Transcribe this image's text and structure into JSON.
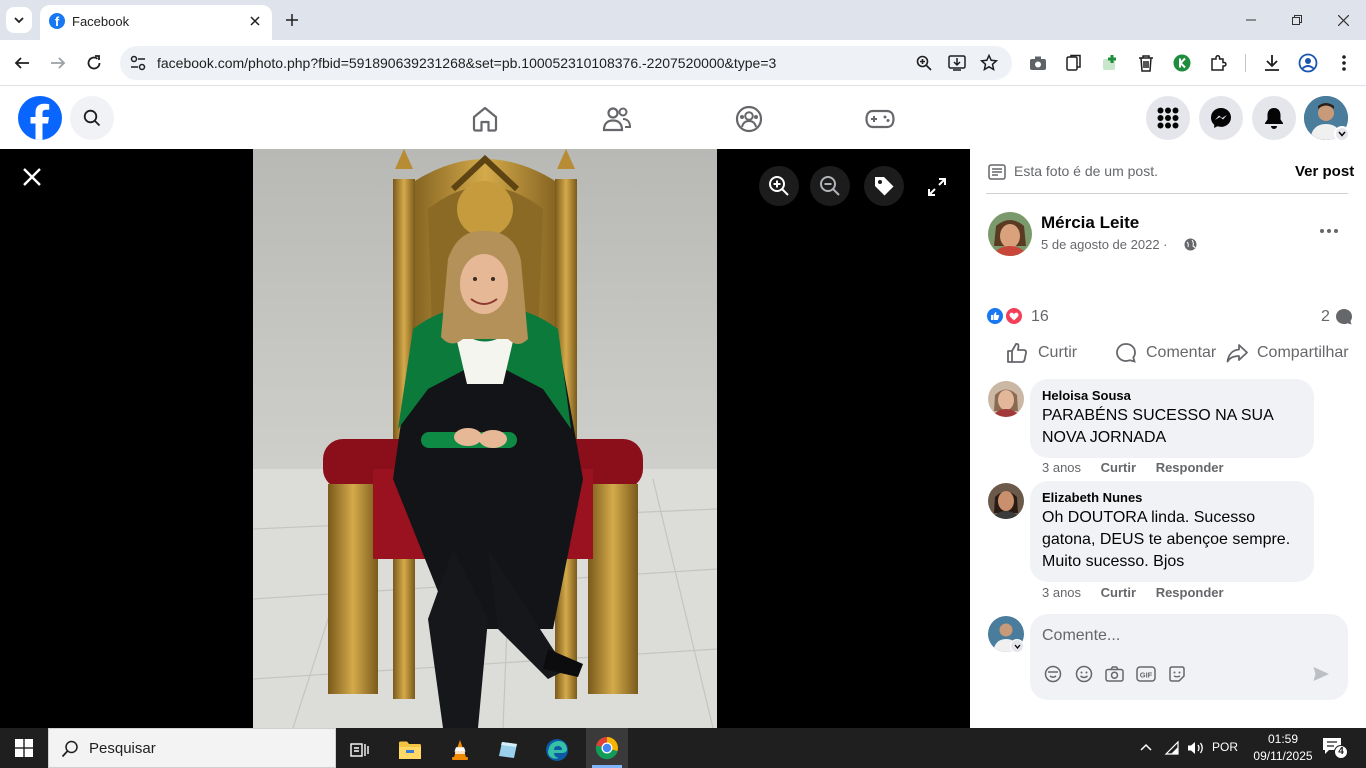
{
  "browser": {
    "tab_title": "Facebook",
    "url": "facebook.com/photo.php?fbid=591890639231268&set=pb.100052310108376.-2207520000&type=3"
  },
  "viewer": {
    "zoom_in": "zoom-in-icon",
    "zoom_out": "zoom-out-icon",
    "tag": "tag-icon",
    "fullscreen": "fullscreen-icon"
  },
  "post": {
    "notice": "Esta foto é de um post.",
    "see_post": "Ver post",
    "author": "Mércia Leite",
    "date": "5 de agosto de 2022 ·",
    "reactions_count": "16",
    "comments_count": "2",
    "actions": {
      "like": "Curtir",
      "comment": "Comentar",
      "share": "Compartilhar"
    }
  },
  "comments": [
    {
      "name": "Heloisa Sousa",
      "text": "PARABÉNS SUCESSO NA SUA NOVA JORNADA",
      "time": "3 anos",
      "like": "Curtir",
      "reply": "Responder"
    },
    {
      "name": "Elizabeth Nunes",
      "text": "Oh DOUTORA linda. Sucesso gatona, DEUS te abençoe sempre. Muito sucesso. Bjos",
      "time": "3 anos",
      "like": "Curtir",
      "reply": "Responder"
    }
  ],
  "composer": {
    "placeholder": "Comente..."
  },
  "taskbar": {
    "search_placeholder": "Pesquisar",
    "language": "POR",
    "time": "01:59",
    "date": "09/11/2025",
    "notifications": "4"
  },
  "colors": {
    "fb_blue": "#0866ff",
    "chrome_frame": "#dfe3eb",
    "taskbar": "#1f1f1f"
  }
}
